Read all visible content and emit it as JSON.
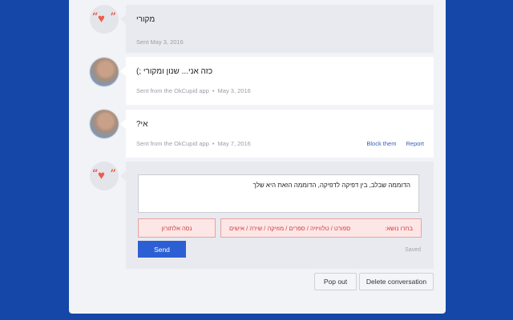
{
  "messages": [
    {
      "text": "מקורי",
      "meta": "Sent May 3, 2016",
      "from": "me"
    },
    {
      "text": "כזה אני... שנון ומקורי ;)",
      "source": "Sent from the OkCupid app",
      "date": "May 3, 2016",
      "from": "them"
    },
    {
      "text": "אי?",
      "source": "Sent from the OkCupid app",
      "date": "May 7, 2016",
      "from": "them",
      "actions": {
        "block": "Block them",
        "report": "Report"
      }
    }
  ],
  "compose": {
    "draft": "הדוממה שבלב, בין דפיקה לדפיקה, הדוממה הזאת היא שלך",
    "chip_left": "נסה אלתורון",
    "chip_right_label": "בחרו נושא:",
    "chip_right_options": "ספורט / טלוויזיה / ספרים / מוזיקה / שירה / אישים",
    "send_label": "Send",
    "saved_label": "Saved"
  },
  "footer": {
    "pop_out": "Pop out",
    "delete": "Delete conversation"
  },
  "colors": {
    "background": "#1447a8",
    "accent": "#2d5fd4",
    "heart": "#ef5a4b",
    "chip_text": "#d33b3b"
  }
}
